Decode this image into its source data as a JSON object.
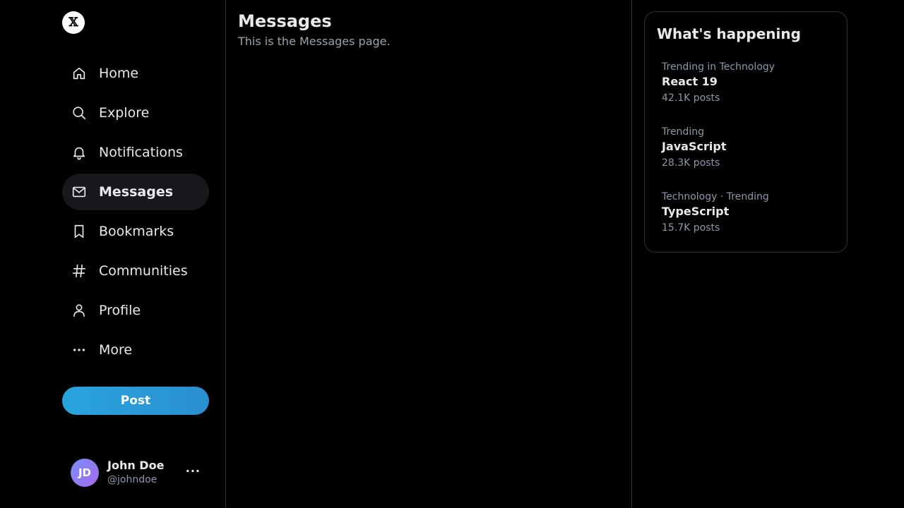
{
  "logo": {
    "glyph": "𝕏"
  },
  "nav": [
    {
      "label": "Home",
      "icon": "home-icon",
      "active": false
    },
    {
      "label": "Explore",
      "icon": "search-icon",
      "active": false
    },
    {
      "label": "Notifications",
      "icon": "bell-icon",
      "active": false
    },
    {
      "label": "Messages",
      "icon": "mail-icon",
      "active": true
    },
    {
      "label": "Bookmarks",
      "icon": "bookmark-icon",
      "active": false
    },
    {
      "label": "Communities",
      "icon": "hashtag-icon",
      "active": false
    },
    {
      "label": "Profile",
      "icon": "user-icon",
      "active": false
    },
    {
      "label": "More",
      "icon": "more-icon",
      "active": false
    }
  ],
  "post_button": "Post",
  "user": {
    "initials": "JD",
    "name": "John Doe",
    "handle": "@johndoe",
    "more": "···"
  },
  "main": {
    "title": "Messages",
    "subtitle": "This is the Messages page."
  },
  "trends": {
    "title": "What's happening",
    "items": [
      {
        "category": "Trending in Technology",
        "name": "React 19",
        "count": "42.1K posts"
      },
      {
        "category": "Trending",
        "name": "JavaScript",
        "count": "28.3K posts"
      },
      {
        "category": "Technology · Trending",
        "name": "TypeScript",
        "count": "15.7K posts"
      }
    ]
  },
  "colors": {
    "background": "#000000",
    "accent": "#1d9bf0",
    "border": "#2f3336",
    "muted": "#8b98a5"
  }
}
